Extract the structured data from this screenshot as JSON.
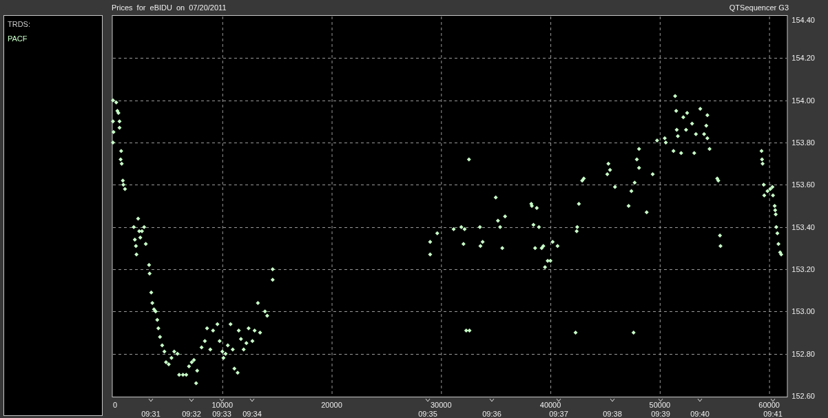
{
  "sidebar": {
    "heading": "TRDS:"
  },
  "header": {
    "product": "QTSequencer G3"
  },
  "time_labels": [
    "09:31",
    "09:32",
    "09:33",
    "09:34",
    "09:35",
    "09:36",
    "09:37",
    "09:38",
    "09:39",
    "09:40",
    "09:41"
  ],
  "chart_data": {
    "type": "scatter",
    "title": "Prices for eBIDU on 07/20/2011",
    "xlim": [
      0,
      61600
    ],
    "ylim": [
      152.6,
      154.4
    ],
    "grid": true,
    "xticks": [
      0,
      10000,
      20000,
      30000,
      40000,
      50000,
      60000
    ],
    "yticks": [
      {
        "value": 152.6,
        "label": "152.60"
      },
      {
        "value": 152.8,
        "label": "152.80"
      },
      {
        "value": 153.0,
        "label": "153.00"
      },
      {
        "value": 153.2,
        "label": "153.20"
      },
      {
        "value": 153.4,
        "label": "153.40"
      },
      {
        "value": 153.6,
        "label": "153.60"
      },
      {
        "value": 153.8,
        "label": "153.80"
      },
      {
        "value": 154.0,
        "label": "154.00"
      },
      {
        "value": 154.2,
        "label": "154.20"
      },
      {
        "value": 154.4,
        "label": "154.40"
      }
    ],
    "x": [
      0,
      0,
      0,
      50,
      300,
      400,
      500,
      600,
      600,
      700,
      750,
      800,
      900,
      950,
      1100,
      1900,
      2000,
      2100,
      2150,
      2300,
      2400,
      2500,
      2650,
      2850,
      3000,
      3300,
      3350,
      3500,
      3600,
      3750,
      3900,
      4050,
      4150,
      4300,
      4500,
      4700,
      4850,
      5100,
      5350,
      5600,
      5900,
      6050,
      6400,
      6700,
      6950,
      7200,
      7400,
      7600,
      7700,
      8100,
      8400,
      8600,
      8900,
      9150,
      9550,
      9750,
      10000,
      10100,
      10300,
      10500,
      10750,
      10950,
      11100,
      11400,
      11500,
      11700,
      11950,
      12200,
      12400,
      12750,
      12950,
      13250,
      13450,
      13900,
      14100,
      14600,
      14600,
      29000,
      29000,
      29650,
      31150,
      31850,
      32050,
      32150,
      32300,
      32550,
      32600,
      33550,
      33600,
      33800,
      35000,
      35200,
      35400,
      35600,
      35850,
      38250,
      38300,
      38450,
      38600,
      38750,
      38950,
      39200,
      39350,
      39500,
      39750,
      40000,
      40200,
      40650,
      42300,
      42400,
      42450,
      42600,
      42900,
      43050,
      45200,
      45300,
      45450,
      45900,
      47150,
      47400,
      47600,
      47700,
      47900,
      48100,
      48100,
      48800,
      49350,
      49750,
      50450,
      50550,
      51250,
      51400,
      51500,
      51550,
      51650,
      51950,
      52150,
      52400,
      52500,
      52950,
      53150,
      53300,
      53700,
      54050,
      54250,
      54350,
      54350,
      54550,
      55250,
      55350,
      55500,
      55550,
      59300,
      59350,
      59400,
      59500,
      59550,
      59850,
      60100,
      60300,
      60350,
      60500,
      60550,
      60600,
      60650,
      60750,
      60850,
      61000,
      61100
    ],
    "series": [
      {
        "name": "PACF",
        "color": "#c8ffc8",
        "values": [
          154.0,
          153.9,
          153.8,
          153.85,
          153.99,
          153.95,
          153.94,
          153.9,
          153.87,
          153.72,
          153.76,
          153.7,
          153.62,
          153.6,
          153.58,
          153.4,
          153.34,
          153.31,
          153.27,
          153.44,
          153.38,
          153.35,
          153.38,
          153.4,
          153.32,
          153.22,
          153.18,
          153.09,
          153.04,
          153.01,
          153.0,
          152.96,
          152.92,
          152.88,
          152.84,
          152.81,
          152.76,
          152.75,
          152.78,
          152.81,
          152.8,
          152.7,
          152.7,
          152.7,
          152.74,
          152.76,
          152.77,
          152.66,
          152.72,
          152.83,
          152.86,
          152.92,
          152.82,
          152.91,
          152.94,
          152.86,
          152.81,
          152.78,
          152.8,
          152.84,
          152.94,
          152.82,
          152.73,
          152.71,
          152.91,
          152.87,
          152.82,
          152.85,
          152.92,
          152.86,
          152.91,
          153.04,
          152.9,
          153.0,
          152.98,
          153.2,
          153.15,
          153.33,
          153.27,
          153.37,
          153.39,
          153.4,
          153.32,
          153.39,
          152.91,
          153.72,
          152.91,
          153.4,
          153.31,
          153.33,
          153.54,
          153.43,
          153.4,
          153.3,
          153.45,
          153.51,
          153.5,
          153.41,
          153.3,
          153.49,
          153.4,
          153.3,
          153.31,
          153.21,
          153.24,
          153.24,
          153.33,
          153.31,
          152.9,
          153.38,
          153.4,
          153.51,
          153.62,
          153.63,
          153.65,
          153.7,
          153.67,
          153.59,
          153.5,
          153.57,
          152.9,
          153.61,
          153.72,
          153.68,
          153.77,
          153.47,
          153.65,
          153.81,
          153.82,
          153.8,
          153.76,
          154.02,
          153.95,
          153.86,
          153.83,
          153.75,
          153.92,
          153.86,
          153.94,
          153.89,
          153.75,
          153.84,
          153.96,
          153.84,
          153.88,
          153.93,
          153.82,
          153.77,
          153.63,
          153.62,
          153.36,
          153.31,
          153.76,
          153.72,
          153.7,
          153.6,
          153.55,
          153.57,
          153.58,
          153.59,
          153.55,
          153.5,
          153.48,
          153.46,
          153.4,
          153.37,
          153.32,
          153.28,
          153.27
        ]
      }
    ]
  }
}
